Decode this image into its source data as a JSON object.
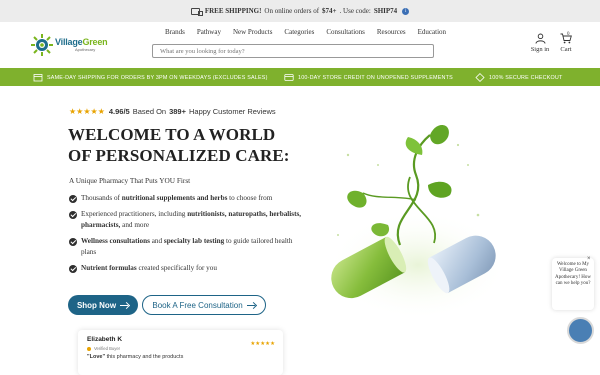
{
  "promo": {
    "label": "FREE SHIPPING!",
    "text": "On online orders of",
    "amount": "$74+",
    "code_text": ". Use code:",
    "code": "SHIP74",
    "info": "i"
  },
  "header": {
    "logo": {
      "name_a": "Village",
      "name_b": "Green",
      "sub": "Apothecary"
    },
    "nav": [
      "Brands",
      "Pathway",
      "New Products",
      "Categories",
      "Consultations",
      "Resources",
      "Education"
    ],
    "search_placeholder": "What are you looking for today?",
    "account_label": "Sign in",
    "cart_label": "Cart",
    "cart_count": "0"
  },
  "benefits": [
    "SAME-DAY SHIPPING FOR ORDERS BY 3PM ON WEEKDAYS (EXCLUDES SALES)",
    "100-DAY STORE CREDIT ON UNOPENED SUPPLEMENTS",
    "100% SECURE CHECKOUT"
  ],
  "hero": {
    "stars": "★★★★★",
    "rating": "4.96/5",
    "based_on": "Based On",
    "review_count": "389+",
    "reviews_text": "Happy Customer Reviews",
    "headline_1": "WELCOME TO A WORLD",
    "headline_2": "OF PERSONALIZED CARE:",
    "tagline": "A Unique Pharmacy That Puts YOU First",
    "features": [
      {
        "pre": "Thousands of ",
        "bold": "nutritional supplements and herbs",
        "post": " to choose from"
      },
      {
        "pre": "Experienced practitioners, including ",
        "bold": "nutritionists, naturopaths, herbalists, pharmacists,",
        "post": " and more"
      },
      {
        "pre": "",
        "bold": "Wellness consultations",
        "post": " and ",
        "bold2": "specialty lab testing",
        "post2": " to guide tailored health plans"
      },
      {
        "pre": "",
        "bold": "Nutrient formulas",
        "post": " created specifically for you"
      }
    ],
    "shop_button": "Shop Now",
    "consult_button": "Book A Free Consultation"
  },
  "review": {
    "author": "Elizabeth K",
    "verified": "Verified Buyer",
    "stars": "★★★★★",
    "quote_bold": "\"Love\"",
    "quote_rest": " this pharmacy and the products"
  },
  "chat": {
    "message": "Welcome to My Village Green Apothecary! How can we help you?",
    "close": "×"
  },
  "colors": {
    "brand_green": "#7fb12d",
    "button_blue": "#1e6487",
    "star_gold": "#e8a300"
  }
}
